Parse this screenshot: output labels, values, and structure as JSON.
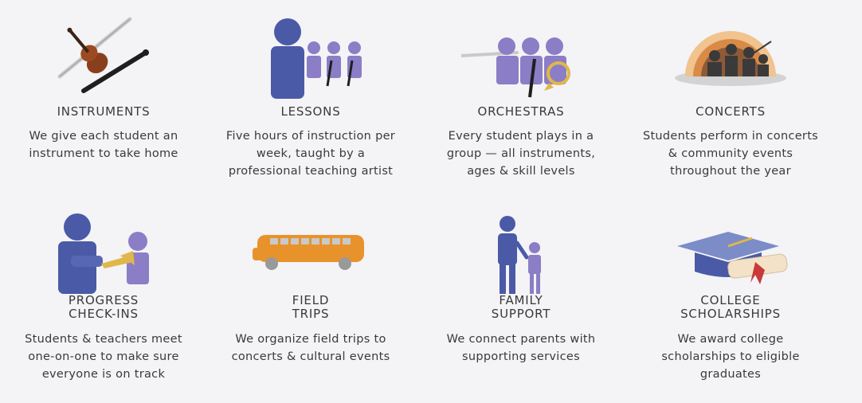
{
  "programs": [
    {
      "title": "INSTRUMENTS",
      "desc_lines": [
        "We give each student an",
        "instrument to take home"
      ]
    },
    {
      "title": "LESSONS",
      "desc_lines": [
        "Five hours of instruction per",
        "week, taught by a",
        "professional teaching artist"
      ]
    },
    {
      "title": "ORCHESTRAS",
      "desc_lines": [
        "Every student plays in a",
        "group — all instruments,",
        "ages & skill levels"
      ]
    },
    {
      "title": "CONCERTS",
      "desc_lines": [
        "Students perform in concerts",
        "& community events",
        "throughout the year"
      ]
    },
    {
      "title_lines": [
        "PROGRESS",
        "CHECK-INS"
      ],
      "desc_lines": [
        "Students & teachers meet",
        "one-on-one to make sure",
        "everyone is on track"
      ]
    },
    {
      "title_lines": [
        "FIELD",
        "TRIPS"
      ],
      "desc_lines": [
        "We organize field trips to",
        "concerts & cultural events"
      ]
    },
    {
      "title_lines": [
        "FAMILY",
        "SUPPORT"
      ],
      "desc_lines": [
        "We connect parents with",
        "supporting services"
      ]
    },
    {
      "title_lines": [
        "COLLEGE",
        "SCHOLARSHIPS"
      ],
      "desc_lines": [
        "We award college",
        "scholarships to eligible",
        "graduates"
      ]
    }
  ],
  "icons": [
    "instruments-icon",
    "lessons-icon",
    "orchestras-icon",
    "concerts-icon",
    "progress-checkins-icon",
    "field-trips-icon",
    "family-support-icon",
    "college-scholarships-icon"
  ],
  "colors": {
    "accent_purple": "#8b7ec6",
    "accent_blue": "#4a5aa6",
    "bus_orange": "#e8922b",
    "text": "#3a3a3a",
    "background": "#f4f3f6"
  }
}
